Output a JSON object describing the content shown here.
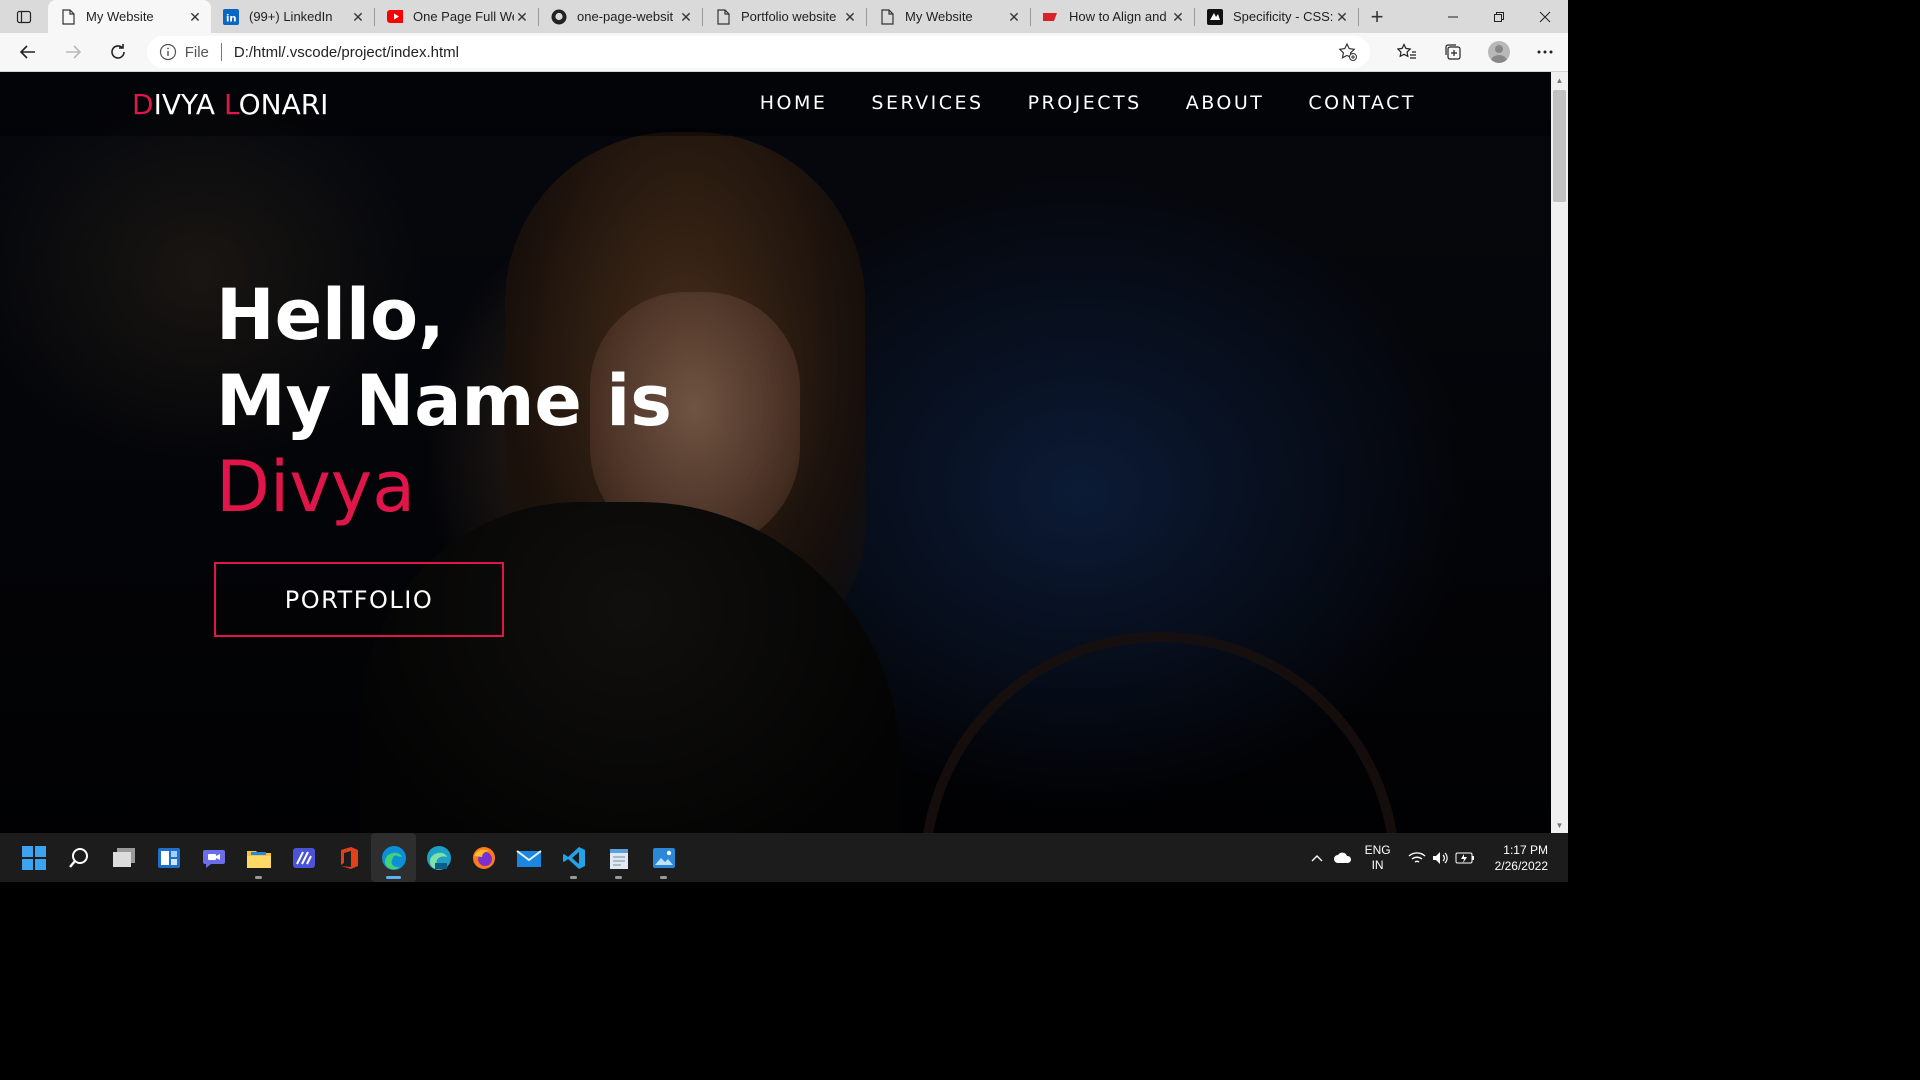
{
  "browser": {
    "tabs": [
      {
        "title": "My Website",
        "icon": "page-icon",
        "active": true
      },
      {
        "title": "(99+) LinkedIn",
        "icon": "linkedin-icon"
      },
      {
        "title": "One Page Full We",
        "icon": "youtube-icon"
      },
      {
        "title": "one-page-websit",
        "icon": "github-icon"
      },
      {
        "title": "Portfolio website",
        "icon": "page-icon"
      },
      {
        "title": "My Website",
        "icon": "page-icon"
      },
      {
        "title": "How to Align and",
        "icon": "w3-icon"
      },
      {
        "title": "Specificity - CSS:",
        "icon": "mdn-icon"
      }
    ],
    "address": {
      "scheme": "File",
      "url": "D:/html/.vscode/project/index.html"
    }
  },
  "site": {
    "logo": {
      "first_initial": "D",
      "first_rest": "IVYA ",
      "last_initial": "L",
      "last_rest": "ONARI"
    },
    "menu": [
      "HOME",
      "SERVICES",
      "PROJECTS",
      "ABOUT",
      "CONTACT"
    ],
    "hero": {
      "line1": "Hello,",
      "line2": "My Name is",
      "name": "Divya"
    },
    "cta": "PORTFOLIO",
    "accent_color": "#e0164a"
  },
  "taskbar": {
    "apps": [
      "start-icon",
      "search-icon",
      "task-view-icon",
      "widgets-icon",
      "chat-icon",
      "file-explorer-icon",
      "code-app-icon",
      "office-icon",
      "edge-icon",
      "edge-beta-icon",
      "firefox-icon",
      "mail-icon",
      "vscode-icon",
      "notepad-icon",
      "photos-icon"
    ],
    "lang_line1": "ENG",
    "lang_line2": "IN",
    "time": "1:17 PM",
    "date": "2/26/2022"
  }
}
